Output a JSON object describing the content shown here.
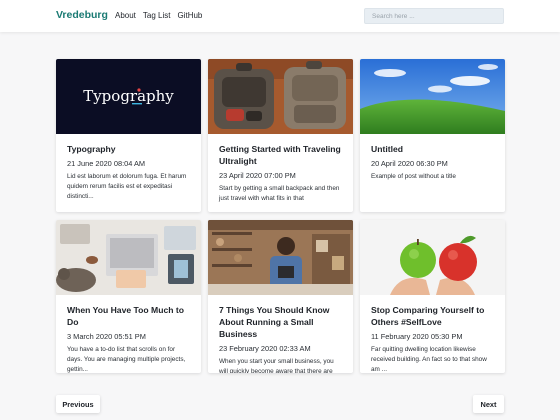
{
  "header": {
    "brand": "Vredeburg",
    "nav": [
      "About",
      "Tag List",
      "GitHub"
    ],
    "search_placeholder": "Search here ..."
  },
  "posts": [
    {
      "title": "Typography",
      "date": "21 June 2020 08:04 AM",
      "excerpt": "Lid est laborum et dolorum fuga. Et harum quidem rerum facilis est et expeditasi distincti...",
      "image_text": "Typography",
      "image": "typography-banner"
    },
    {
      "title": "Getting Started with Traveling Ultralight",
      "date": "23 April 2020 07:00 PM",
      "excerpt": "Start by getting a small backpack and then just travel with what fits in that",
      "image": "backpacks-photo"
    },
    {
      "title": "Untitled",
      "date": "20 April 2020 06:30 PM",
      "excerpt": "Example of post without a title",
      "image": "green-hill-landscape"
    },
    {
      "title": "When You Have Too Much to Do",
      "date": "3 March 2020 05:51 PM",
      "excerpt": "You have a to-do list that scrolls on for days. You are managing multiple projects, gettin...",
      "image": "desk-laptop-cat"
    },
    {
      "title": "7 Things You Should Know About Running a Small Business",
      "date": "23 February 2020 02:33 AM",
      "excerpt": "When you start your small business, you will quickly become aware that there are many othe...",
      "image": "shop-owner-tablet"
    },
    {
      "title": "Stop Comparing Yourself to Others #SelfLove",
      "date": "11 February 2020 05:30 PM",
      "excerpt": "Far quitting dwelling location likewise received building. An fact so to that show am ...",
      "image": "apples-in-hands"
    }
  ],
  "pagination": {
    "previous": "Previous",
    "next": "Next"
  },
  "colors": {
    "brand": "#1a7a73",
    "background": "#f7f7f8",
    "card": "#ffffff"
  }
}
